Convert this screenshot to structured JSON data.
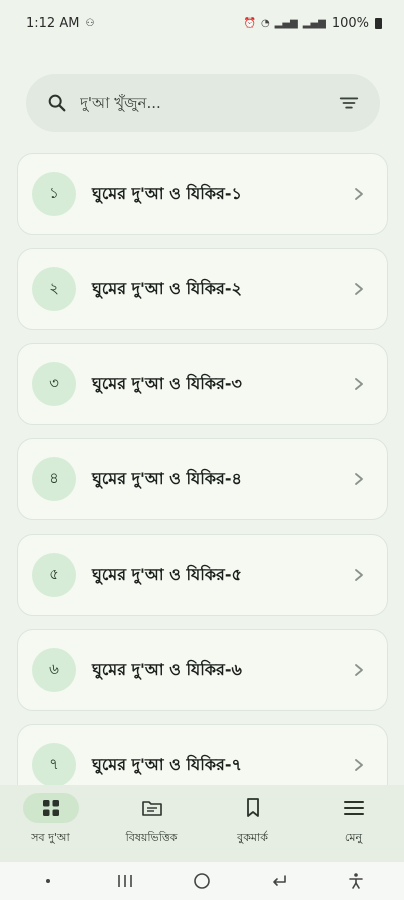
{
  "status_bar": {
    "time": "1:12 AM",
    "battery": "100%"
  },
  "search": {
    "placeholder": "দু'আ খুঁজুন..."
  },
  "duas": [
    {
      "number": "১",
      "title": "ঘুমের দু'আ ও যিকির-১"
    },
    {
      "number": "২",
      "title": "ঘুমের দু'আ ও যিকির-২"
    },
    {
      "number": "৩",
      "title": "ঘুমের দু'আ ও যিকির-৩"
    },
    {
      "number": "৪",
      "title": "ঘুমের দু'আ ও যিকির-৪"
    },
    {
      "number": "৫",
      "title": "ঘুমের দু'আ ও যিকির-৫"
    },
    {
      "number": "৬",
      "title": "ঘুমের দু'আ ও যিকির-৬"
    },
    {
      "number": "৭",
      "title": "ঘুমের দু'আ ও যিকির-৭"
    }
  ],
  "bottom_nav": [
    {
      "label": "সব দু'আ",
      "icon": "grid-icon",
      "active": true
    },
    {
      "label": "বিষয়ভিত্তিক",
      "icon": "folder-icon",
      "active": false
    },
    {
      "label": "বুকমার্ক",
      "icon": "bookmark-icon",
      "active": false
    },
    {
      "label": "মেনু",
      "icon": "menu-icon",
      "active": false
    }
  ],
  "colors": {
    "background": "#eef4ec",
    "badge": "#d6ecd6",
    "active_nav": "#cfe6cc"
  }
}
